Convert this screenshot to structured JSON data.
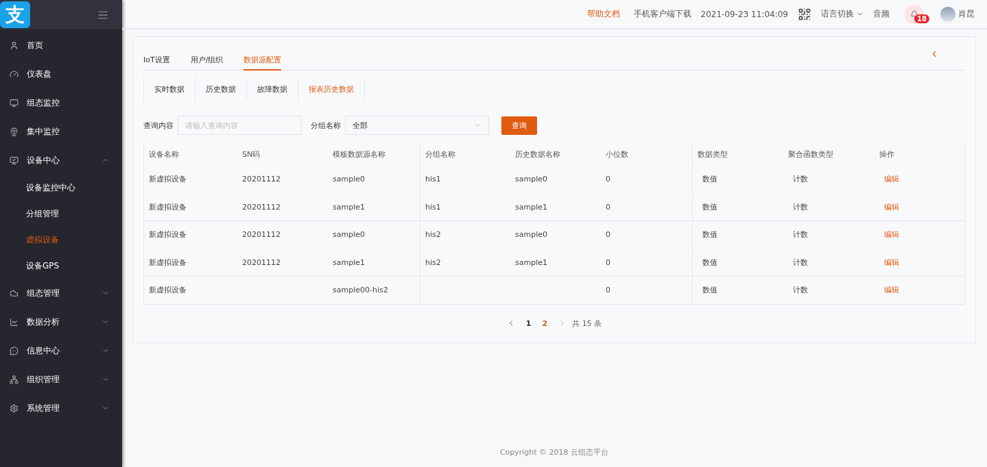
{
  "logo": {
    "glyph": "支"
  },
  "sidebar": {
    "items": [
      {
        "label": "首页"
      },
      {
        "label": "仪表盘"
      },
      {
        "label": "组态监控"
      },
      {
        "label": "集中监控"
      },
      {
        "label": "设备中心",
        "expanded": true,
        "children": [
          {
            "label": "设备监控中心",
            "selected": false
          },
          {
            "label": "分组管理",
            "selected": false
          },
          {
            "label": "虚拟设备",
            "selected": true
          },
          {
            "label": "设备GPS",
            "selected": false
          }
        ]
      },
      {
        "label": "组态管理",
        "expanded": false
      },
      {
        "label": "数据分析",
        "expanded": false
      },
      {
        "label": "信息中心",
        "expanded": false
      },
      {
        "label": "组织管理",
        "expanded": false
      },
      {
        "label": "系统管理",
        "expanded": false
      }
    ]
  },
  "header": {
    "help": "帮助文档",
    "download": "手机客户端下载",
    "datetime": "2021-09-23 11:04:09",
    "language": "语言切换",
    "audio": "音频",
    "notifications": "18",
    "user": "肖昆"
  },
  "tabs": [
    {
      "label": "IoT设置",
      "selected": false
    },
    {
      "label": "用户/组织",
      "selected": false
    },
    {
      "label": "数据源配置",
      "selected": true
    }
  ],
  "subtabs": [
    {
      "label": "实时数据",
      "selected": false
    },
    {
      "label": "历史数据",
      "selected": false
    },
    {
      "label": "故障数据",
      "selected": false
    },
    {
      "label": "报表历史数据",
      "selected": true
    }
  ],
  "filters": {
    "query_label": "查询内容",
    "query_placeholder": "请输入查询内容",
    "group_label": "分组名称",
    "group_value": "全部",
    "search_button": "查询"
  },
  "table": {
    "columns": [
      "设备名称",
      "SN码",
      "模板数据源名称",
      "分组名称",
      "历史数据名称",
      "小位数",
      "数据类型",
      "聚合函数类型",
      "操作"
    ],
    "rows": [
      {
        "cells": [
          "新虚拟设备",
          "20201112",
          "sample0",
          "his1",
          "sample0",
          "0",
          "数值",
          "计数",
          "编辑"
        ]
      },
      {
        "group_start": false,
        "cells": [
          "新虚拟设备",
          "20201112",
          "sample1",
          "his1",
          "sample1",
          "0",
          "数值",
          "计数",
          "编辑"
        ]
      },
      {
        "group_start": true,
        "cells": [
          "新虚拟设备",
          "20201112",
          "sample0",
          "his2",
          "sample0",
          "0",
          "数值",
          "计数",
          "编辑"
        ]
      },
      {
        "group_start": false,
        "cells": [
          "新虚拟设备",
          "20201112",
          "sample1",
          "his2",
          "sample1",
          "0",
          "数值",
          "计数",
          "编辑"
        ]
      },
      {
        "group_start": true,
        "cells": [
          "新虚拟设备",
          "",
          "sample00-his2",
          "",
          "",
          "0",
          "数值",
          "计数",
          "编辑"
        ]
      }
    ]
  },
  "pagination": {
    "pages": [
      {
        "label": "1",
        "selected": false
      },
      {
        "label": "2",
        "selected": true
      }
    ],
    "total": "共 15 条"
  },
  "footer": "Copyright © 2018 云组态平台"
}
